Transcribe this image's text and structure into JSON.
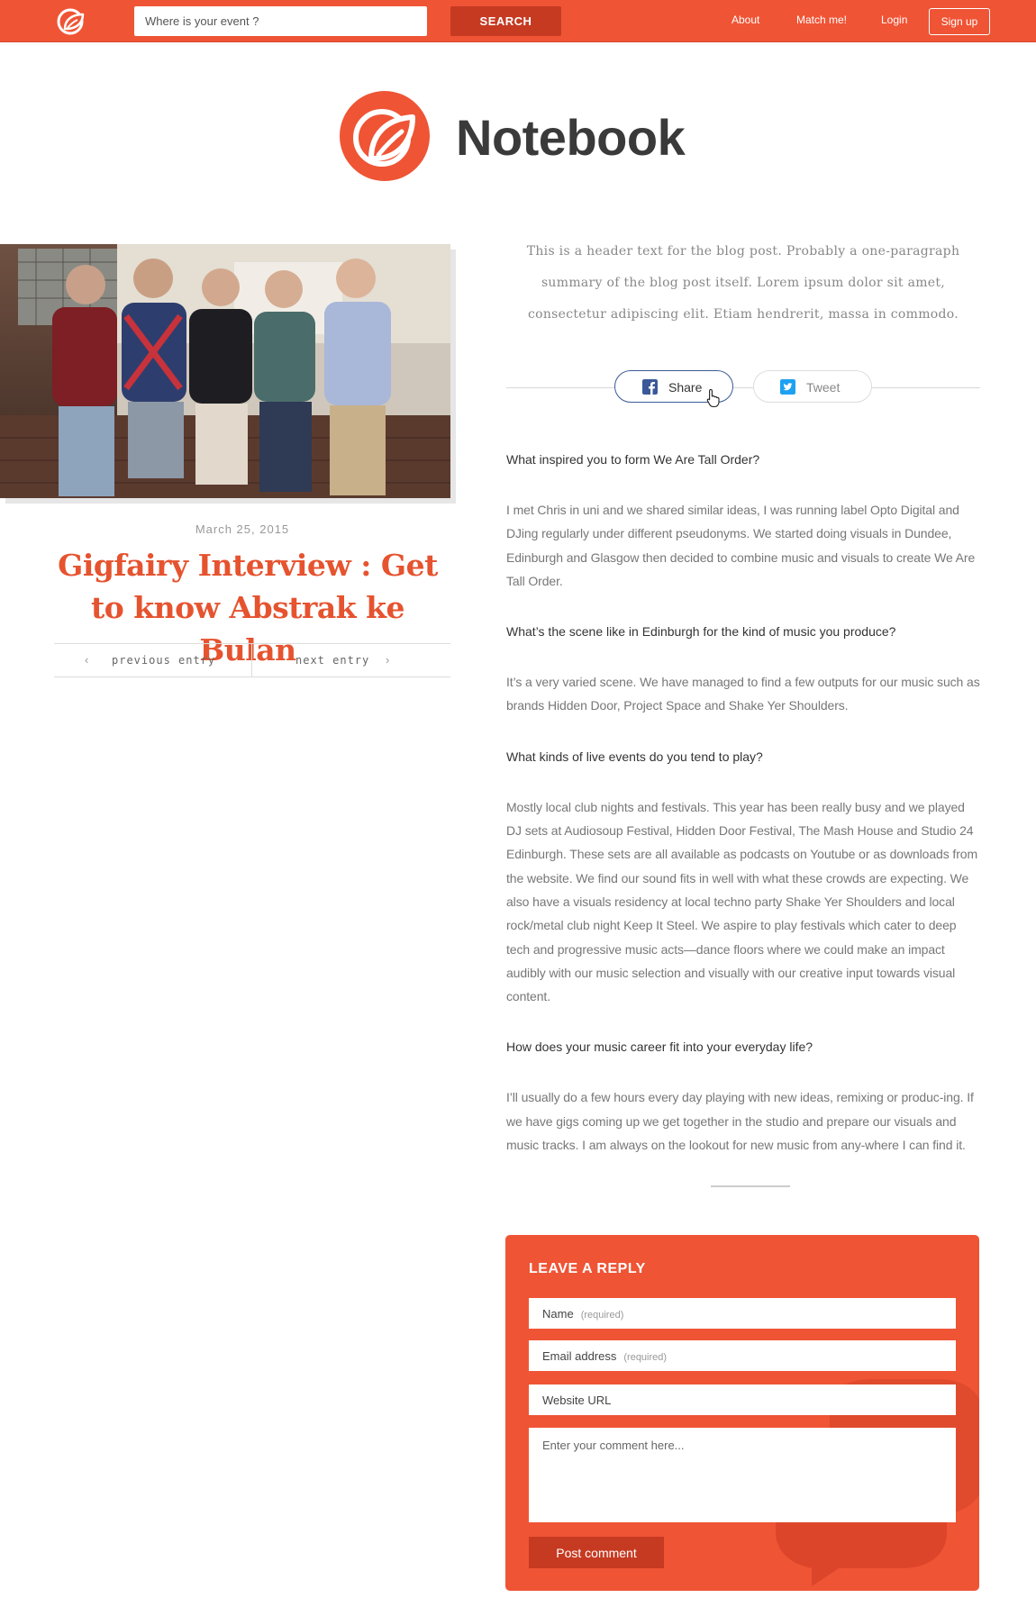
{
  "topbar": {
    "search_placeholder": "Where is your event ?",
    "search_label": "SEARCH",
    "nav": [
      {
        "label": "About"
      },
      {
        "label": "Match me!"
      },
      {
        "label": "Login"
      }
    ],
    "signup_label": "Sign up"
  },
  "brand": {
    "title": "Notebook",
    "color": "#ef5435"
  },
  "post": {
    "date": "March 25, 2015",
    "title": "Gigfairy Interview : Get to know Abstrak ke Bulan",
    "intro": "This is a header text for the blog post. Probably a one-paragraph summary of the blog post itself. Lorem ipsum dolor sit amet, consectetur adipiscing elit. Etiam hendrerit, massa in commodo.",
    "nav": {
      "previous": "previous entry",
      "next": "next entry"
    }
  },
  "share": {
    "share_label": "Share",
    "tweet_label": "Tweet"
  },
  "article": [
    {
      "q": "What inspired you to form We Are Tall Order?",
      "a": "I met Chris in uni and we shared similar ideas, I was running label Opto Digital and DJing regularly under different pseudonyms. We started doing visuals in Dundee, Edinburgh and Glasgow then decided to combine music and visuals to create We Are Tall Order."
    },
    {
      "q": "What’s the scene like in Edinburgh for the kind of music you produce?",
      "a": "It’s a very varied scene. We have managed to find a few outputs for our music such as brands Hidden Door, Project Space and Shake Yer Shoulders."
    },
    {
      "q": "What kinds of live events do you tend to play?",
      "a": "Mostly local club nights and festivals. This year has been really busy and we played DJ sets at Audiosoup Festival, Hidden Door Festival, The Mash House and Studio 24 Edinburgh. These sets are all available as podcasts on Youtube or as downloads from the website. We find our sound fits in well with what these crowds are expecting. We also have a visuals residency at local techno party Shake Yer Shoulders and local rock/metal club night Keep It Steel. We aspire to play festivals which cater to deep tech and progressive music acts—dance floors where we could make an impact audibly with our music selection and visually with our creative input towards visual content."
    },
    {
      "q": "How does your music career fit into your everyday life?",
      "a": "I’ll usually do a few hours every day playing with new ideas, remixing or produc-ing. If we have gigs coming up we get together in the studio and prepare our visuals and music tracks. I am always on the lookout for new music from any-where I can find it."
    }
  ],
  "reply": {
    "title": "LEAVE A REPLY",
    "name_label": "Name",
    "email_label": "Email address",
    "required": "(required)",
    "website_label": "Website URL",
    "comment_placeholder": "Enter your comment here...",
    "submit_label": "Post comment"
  }
}
